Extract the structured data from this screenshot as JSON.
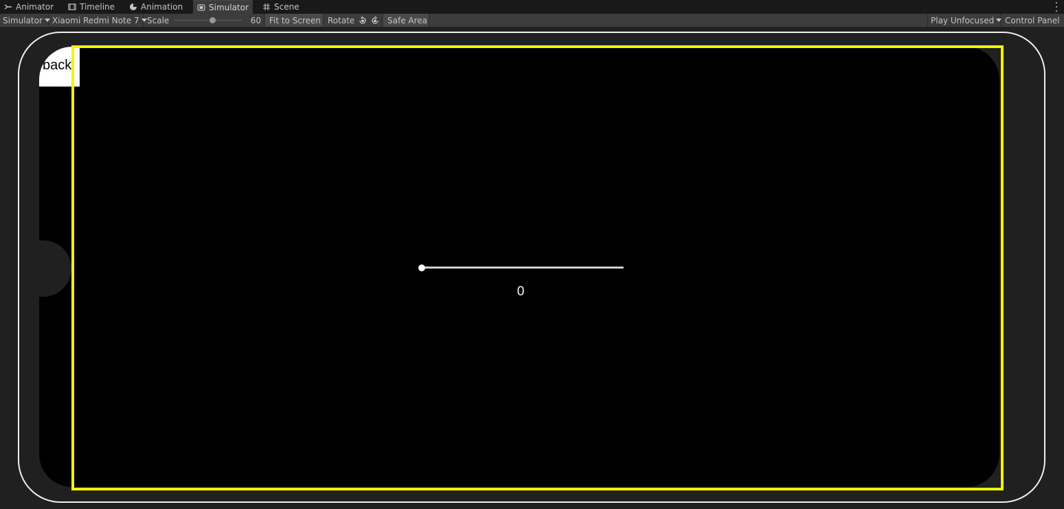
{
  "tabs": [
    {
      "label": "Animator",
      "icon": "animator-icon"
    },
    {
      "label": "Timeline",
      "icon": "timeline-icon"
    },
    {
      "label": "Animation",
      "icon": "animation-icon"
    },
    {
      "label": "Simulator",
      "icon": "simulator-icon",
      "active": true
    },
    {
      "label": "Scene",
      "icon": "scene-grid-icon"
    }
  ],
  "toolbar": {
    "mode_dropdown": "Simulator",
    "device_dropdown": "Xiaomi Redmi Note 7",
    "scale_label": "Scale",
    "scale_value": "60",
    "fit_to_screen": "Fit to Screen",
    "rotate_label": "Rotate",
    "safe_area": "Safe Area",
    "play_mode_dropdown": "Play Unfocused",
    "control_panel": "Control Panel"
  },
  "game": {
    "back_button": "back",
    "slider_value": "0"
  },
  "colors": {
    "safe_area_outline": "#f2f500",
    "device_frame": "#f0f0f0",
    "screen_background": "#000000"
  }
}
